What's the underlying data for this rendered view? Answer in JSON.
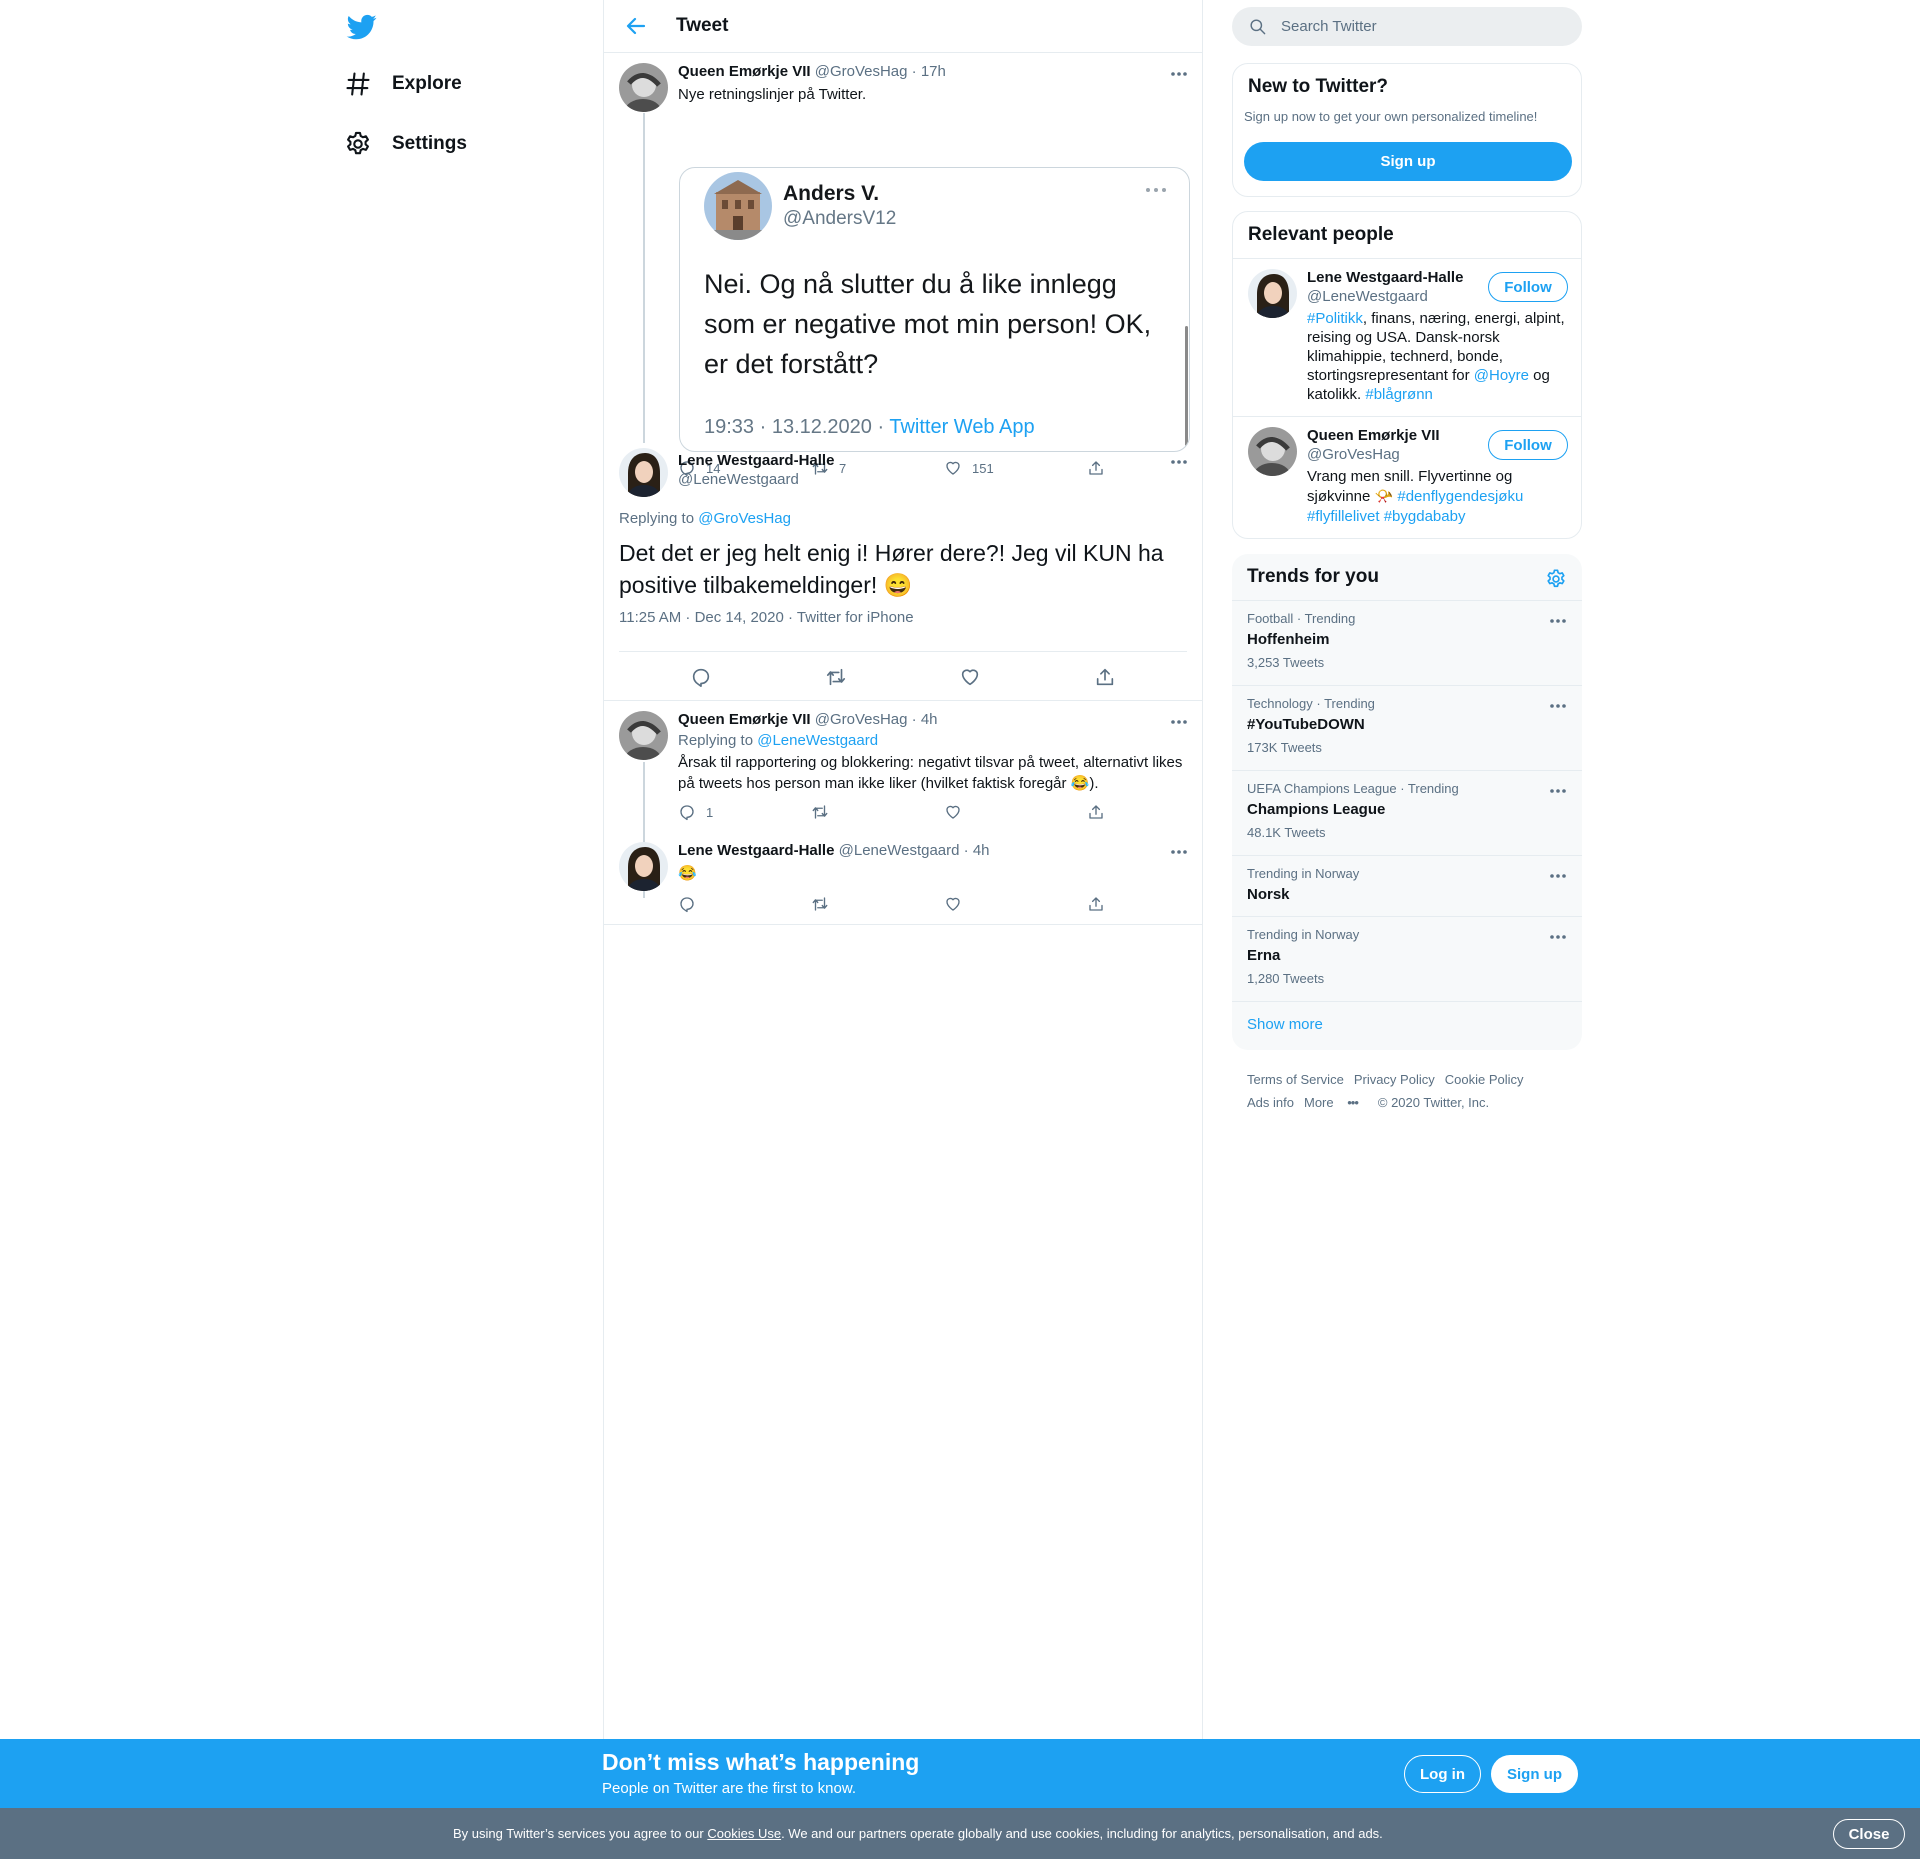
{
  "nav": {
    "explore": "Explore",
    "settings": "Settings"
  },
  "header": {
    "title": "Tweet"
  },
  "tweet1": {
    "name": "Queen Emørkje VII",
    "handle": "@GroVesHag",
    "time": "17h",
    "text": "Nye retningslinjer på Twitter.",
    "card": {
      "name": "Anders V.",
      "handle": "@AndersV12",
      "text": "Nei. Og nå slutter du å like innlegg som er negative mot min person! OK, er det forstått?",
      "time": "19:33 · 13.12.2020 · ",
      "app": "Twitter Web App"
    },
    "replies": "14",
    "retweets": "7",
    "likes": "151"
  },
  "focal": {
    "name": "Lene Westgaard-Halle",
    "handle": "@LeneWestgaard",
    "replying_prefix": "Replying to ",
    "replying_to": "@GroVesHag",
    "text": "Det det er jeg helt enig i! Hører dere?! Jeg vil KUN ha positive tilbakemeldinger! 😄",
    "meta": "11:25 AM · Dec 14, 2020 · Twitter for iPhone"
  },
  "tweet3": {
    "name": "Queen Emørkje VII",
    "handle": "@GroVesHag",
    "time": "4h",
    "replying_prefix": "Replying to ",
    "replying_to": "@LeneWestgaard",
    "text": "Årsak til rapportering og blokkering: negativt tilsvar på tweet, alternativt likes på tweets hos person man ikke liker (hvilket faktisk foregår 😂).",
    "replies": "1"
  },
  "tweet4": {
    "name": "Lene Westgaard-Halle",
    "handle": "@LeneWestgaard",
    "time": "4h",
    "text": "😂"
  },
  "search": {
    "placeholder": "Search Twitter"
  },
  "new_to_twitter": {
    "title": "New to Twitter?",
    "text": "Sign up now to get your own personalized timeline!",
    "button": "Sign up"
  },
  "relevant": {
    "title": "Relevant people",
    "people": [
      {
        "name": "Lene Westgaard-Halle",
        "handle": "@LeneWestgaard",
        "follow": "Follow",
        "bio_tag1": "#Politikk",
        "bio_a": ", finans, næring, energi, alpint, reising og USA. Dansk-norsk klimahippie, technerd, bonde, stortingsrepresentant for ",
        "bio_mention": "@Hoyre",
        "bio_b": " og katolikk. ",
        "bio_tag2": "#blågrønn"
      },
      {
        "name": "Queen Emørkje VII",
        "handle": "@GroVesHag",
        "follow": "Follow",
        "bio_a": "Vrang men snill. Flyvertinne og sjøkvinne 📯 ",
        "bio_tag1": "#denflygendesjøku",
        "bio_tag2": "#flyfillelivet",
        "bio_tag3": "#bygdababy"
      }
    ]
  },
  "trends": {
    "title": "Trends for you",
    "items": [
      {
        "context": "Football · Trending",
        "name": "Hoffenheim",
        "count": "3,253 Tweets"
      },
      {
        "context": "Technology · Trending",
        "name": "#YouTubeDOWN",
        "count": "173K Tweets"
      },
      {
        "context": "UEFA Champions League · Trending",
        "name": "Champions League",
        "count": "48.1K Tweets"
      },
      {
        "context": "Trending in Norway",
        "name": "Norsk",
        "count": ""
      },
      {
        "context": "Trending in Norway",
        "name": "Erna",
        "count": "1,280 Tweets"
      }
    ],
    "show_more": "Show more"
  },
  "footer": {
    "terms": "Terms of Service",
    "privacy": "Privacy Policy",
    "cookie": "Cookie Policy",
    "ads": "Ads info",
    "more": "More",
    "copyright": "© 2020 Twitter, Inc."
  },
  "bottom_bar": {
    "title": "Don’t miss what’s happening",
    "subtitle": "People on Twitter are the first to know.",
    "login": "Log in",
    "signup": "Sign up"
  },
  "cookie_bar": {
    "prefix": "By using Twitter’s services you agree to our ",
    "link": "Cookies Use",
    "suffix": ". We and our partners operate globally and use cookies, including for analytics, personalisation, and ads.",
    "close": "Close"
  },
  "colors": {
    "accent": "#1da1f2",
    "text": "#0f1419",
    "secondary": "#5b7083",
    "border": "#e6ecf0"
  }
}
